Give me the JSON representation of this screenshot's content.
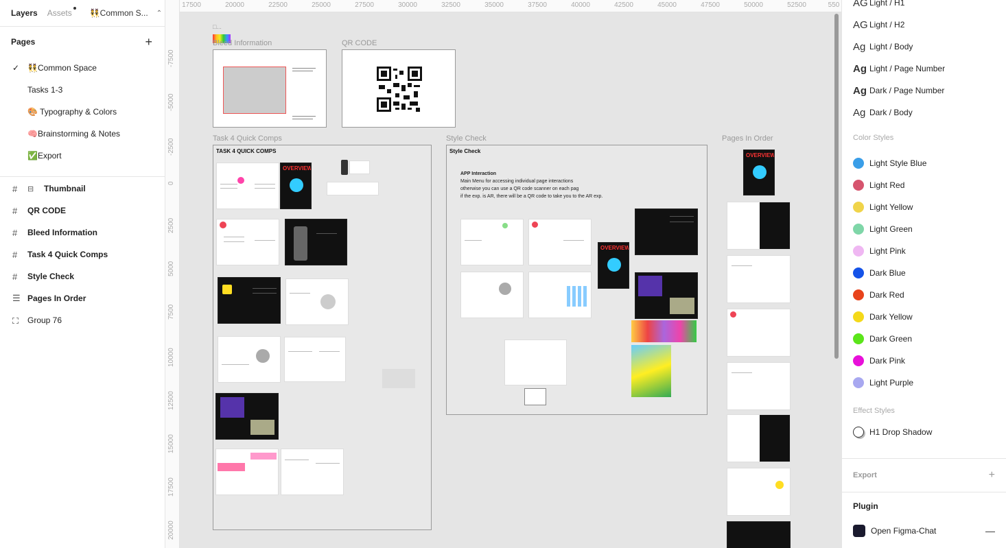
{
  "left_panel": {
    "tabs": {
      "layers": "Layers",
      "assets": "Assets"
    },
    "page_switcher": "👯Common S...",
    "pages_title": "Pages",
    "pages": [
      {
        "label": "👯Common Space",
        "selected": true
      },
      {
        "label": "Tasks 1-3",
        "selected": false
      },
      {
        "label": "🎨 Typography & Colors",
        "selected": false
      },
      {
        "label": "🧠Brainstorming & Notes",
        "selected": false
      },
      {
        "label": "✅Export",
        "selected": false
      }
    ],
    "layers": [
      {
        "label": "Thumbnail",
        "icon": "frame-icon",
        "extra_icon": "component-icon"
      },
      {
        "label": "QR CODE",
        "icon": "frame-icon"
      },
      {
        "label": "Bleed Information",
        "icon": "frame-icon"
      },
      {
        "label": "Task 4 Quick Comps",
        "icon": "frame-icon"
      },
      {
        "label": "Style Check",
        "icon": "frame-icon"
      },
      {
        "label": "Pages In Order",
        "icon": "auto-layout-icon"
      },
      {
        "label": "Group 76",
        "icon": "group-icon"
      }
    ]
  },
  "canvas": {
    "ruler_x": [
      "17500",
      "20000",
      "22500",
      "25000",
      "27500",
      "30000",
      "32500",
      "35000",
      "37500",
      "40000",
      "42500",
      "45000",
      "47500",
      "50000",
      "52500",
      "550"
    ],
    "ruler_y": [
      "-7500",
      "-5000",
      "-2500",
      "0",
      "2500",
      "5000",
      "7500",
      "10000",
      "12500",
      "15000",
      "17500",
      "20000"
    ],
    "frames": {
      "small_label": "□...",
      "bleed": "Bleed Information",
      "qr": "QR CODE",
      "task4": "Task 4 Quick Comps",
      "task4_inner": "TASK 4 QUICK COMPS",
      "style": "Style Check",
      "style_inner": "Style Check",
      "pages": "Pages In Order"
    },
    "style_check_text": {
      "heading": "APP Interaction",
      "lines": [
        "Main Menu for accessing individual page interactions",
        "otherwise you can use a QR code scanner on each pag",
        "if the exp. is AR, there will be a QR code to take you to the AR exp."
      ]
    },
    "overview_label": "OVERVIEW"
  },
  "right_panel": {
    "text_styles": [
      {
        "label": "Light / H1",
        "icon": "AG"
      },
      {
        "label": "Light / H2",
        "icon": "AG"
      },
      {
        "label": "Light / Body",
        "icon": "Ag"
      },
      {
        "label": "Light / Page Number",
        "icon": "Ag"
      },
      {
        "label": "Dark / Page Number",
        "icon": "Ag"
      },
      {
        "label": "Dark / Body",
        "icon": "Ag"
      }
    ],
    "color_styles_title": "Color Styles",
    "color_styles": [
      {
        "label": "Light Style Blue",
        "color": "#3a9ee8"
      },
      {
        "label": "Light Red",
        "color": "#d6546e"
      },
      {
        "label": "Light Yellow",
        "color": "#f0d44a"
      },
      {
        "label": "Light Green",
        "color": "#7fd6a8"
      },
      {
        "label": "Light Pink",
        "color": "#efb7f2"
      },
      {
        "label": "Dark Blue",
        "color": "#1553e8"
      },
      {
        "label": "Dark Red",
        "color": "#e8431b"
      },
      {
        "label": "Dark Yellow",
        "color": "#f4d91a"
      },
      {
        "label": "Dark Green",
        "color": "#5be51a"
      },
      {
        "label": "Dark Pink",
        "color": "#e810d9"
      },
      {
        "label": "Light Purple",
        "color": "#a8a8f0"
      }
    ],
    "effect_styles_title": "Effect Styles",
    "effect_styles": [
      {
        "label": "H1 Drop Shadow"
      }
    ],
    "export_title": "Export",
    "plugin_title": "Plugin",
    "plugins": [
      {
        "label": "Open Figma-Chat"
      }
    ]
  }
}
